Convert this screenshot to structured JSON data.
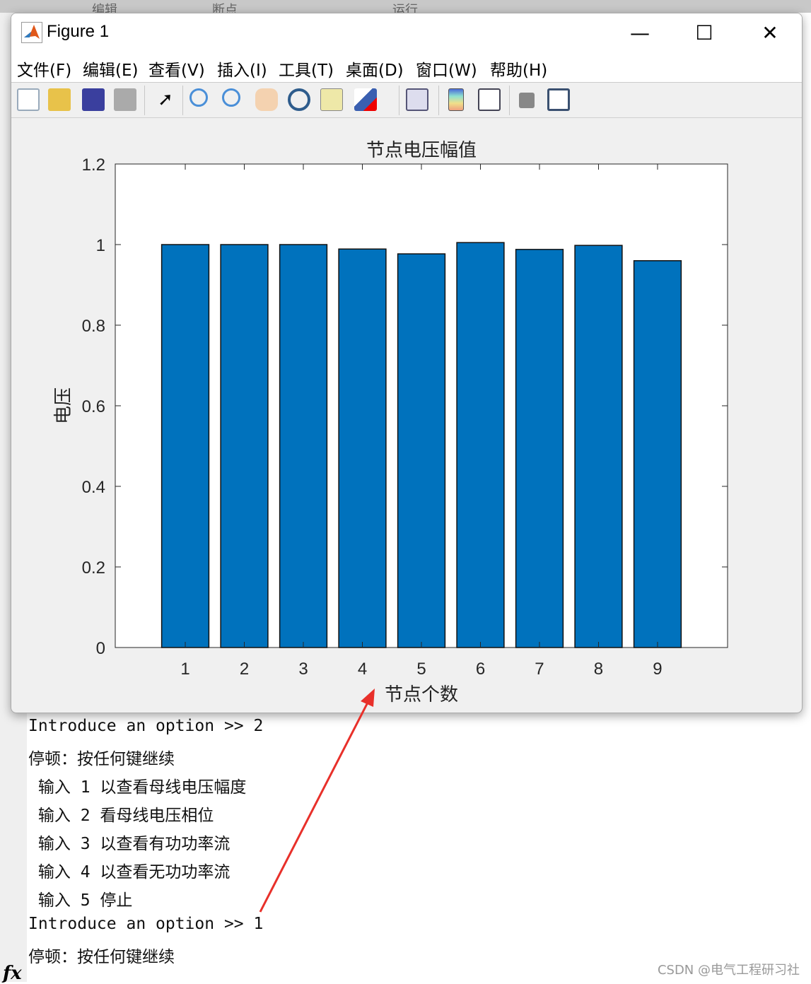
{
  "background": {
    "tabs": [
      "编辑",
      "断点",
      "运行"
    ]
  },
  "window": {
    "title": "Figure 1",
    "minimize": "—",
    "maximize": "☐",
    "close": "✕"
  },
  "menu": [
    "文件(F)",
    "编辑(E)",
    "查看(V)",
    "插入(I)",
    "工具(T)",
    "桌面(D)",
    "窗口(W)",
    "帮助(H)"
  ],
  "toolbar": [
    "new-figure",
    "open",
    "save",
    "print",
    "select",
    "zoom-in",
    "zoom-out",
    "pan",
    "rotate-3d",
    "data-cursor",
    "brush",
    "link",
    "colorbar",
    "legend",
    "hide-plot-tools",
    "show-plot-tools"
  ],
  "chart_data": {
    "type": "bar",
    "title": "节点电压幅值",
    "xlabel": "节点个数",
    "ylabel": "电压",
    "categories": [
      "1",
      "2",
      "3",
      "4",
      "5",
      "6",
      "7",
      "8",
      "9"
    ],
    "values": [
      1.0,
      1.0,
      1.0,
      0.989,
      0.977,
      1.005,
      0.988,
      0.998,
      0.96
    ],
    "ylim": [
      0,
      1.2
    ],
    "yticks": [
      "0",
      "0.2",
      "0.4",
      "0.6",
      "0.8",
      "1",
      "1.2"
    ],
    "color": "#0072BD",
    "grid": false
  },
  "console": {
    "lines": [
      "Introduce an option >> 2",
      "停顿：按任何键继续",
      " 输入 1 以查看母线电压幅度",
      " 输入 2 看母线电压相位",
      " 输入 3 以查看有功功率流",
      " 输入 4 以查看无功功率流",
      " 输入 5 停止",
      "Introduce an option >> 1",
      "停顿：按任何键继续"
    ],
    "fx": "fx"
  },
  "watermark": "CSDN @电气工程研习社",
  "annotation_color": "#e8302a"
}
